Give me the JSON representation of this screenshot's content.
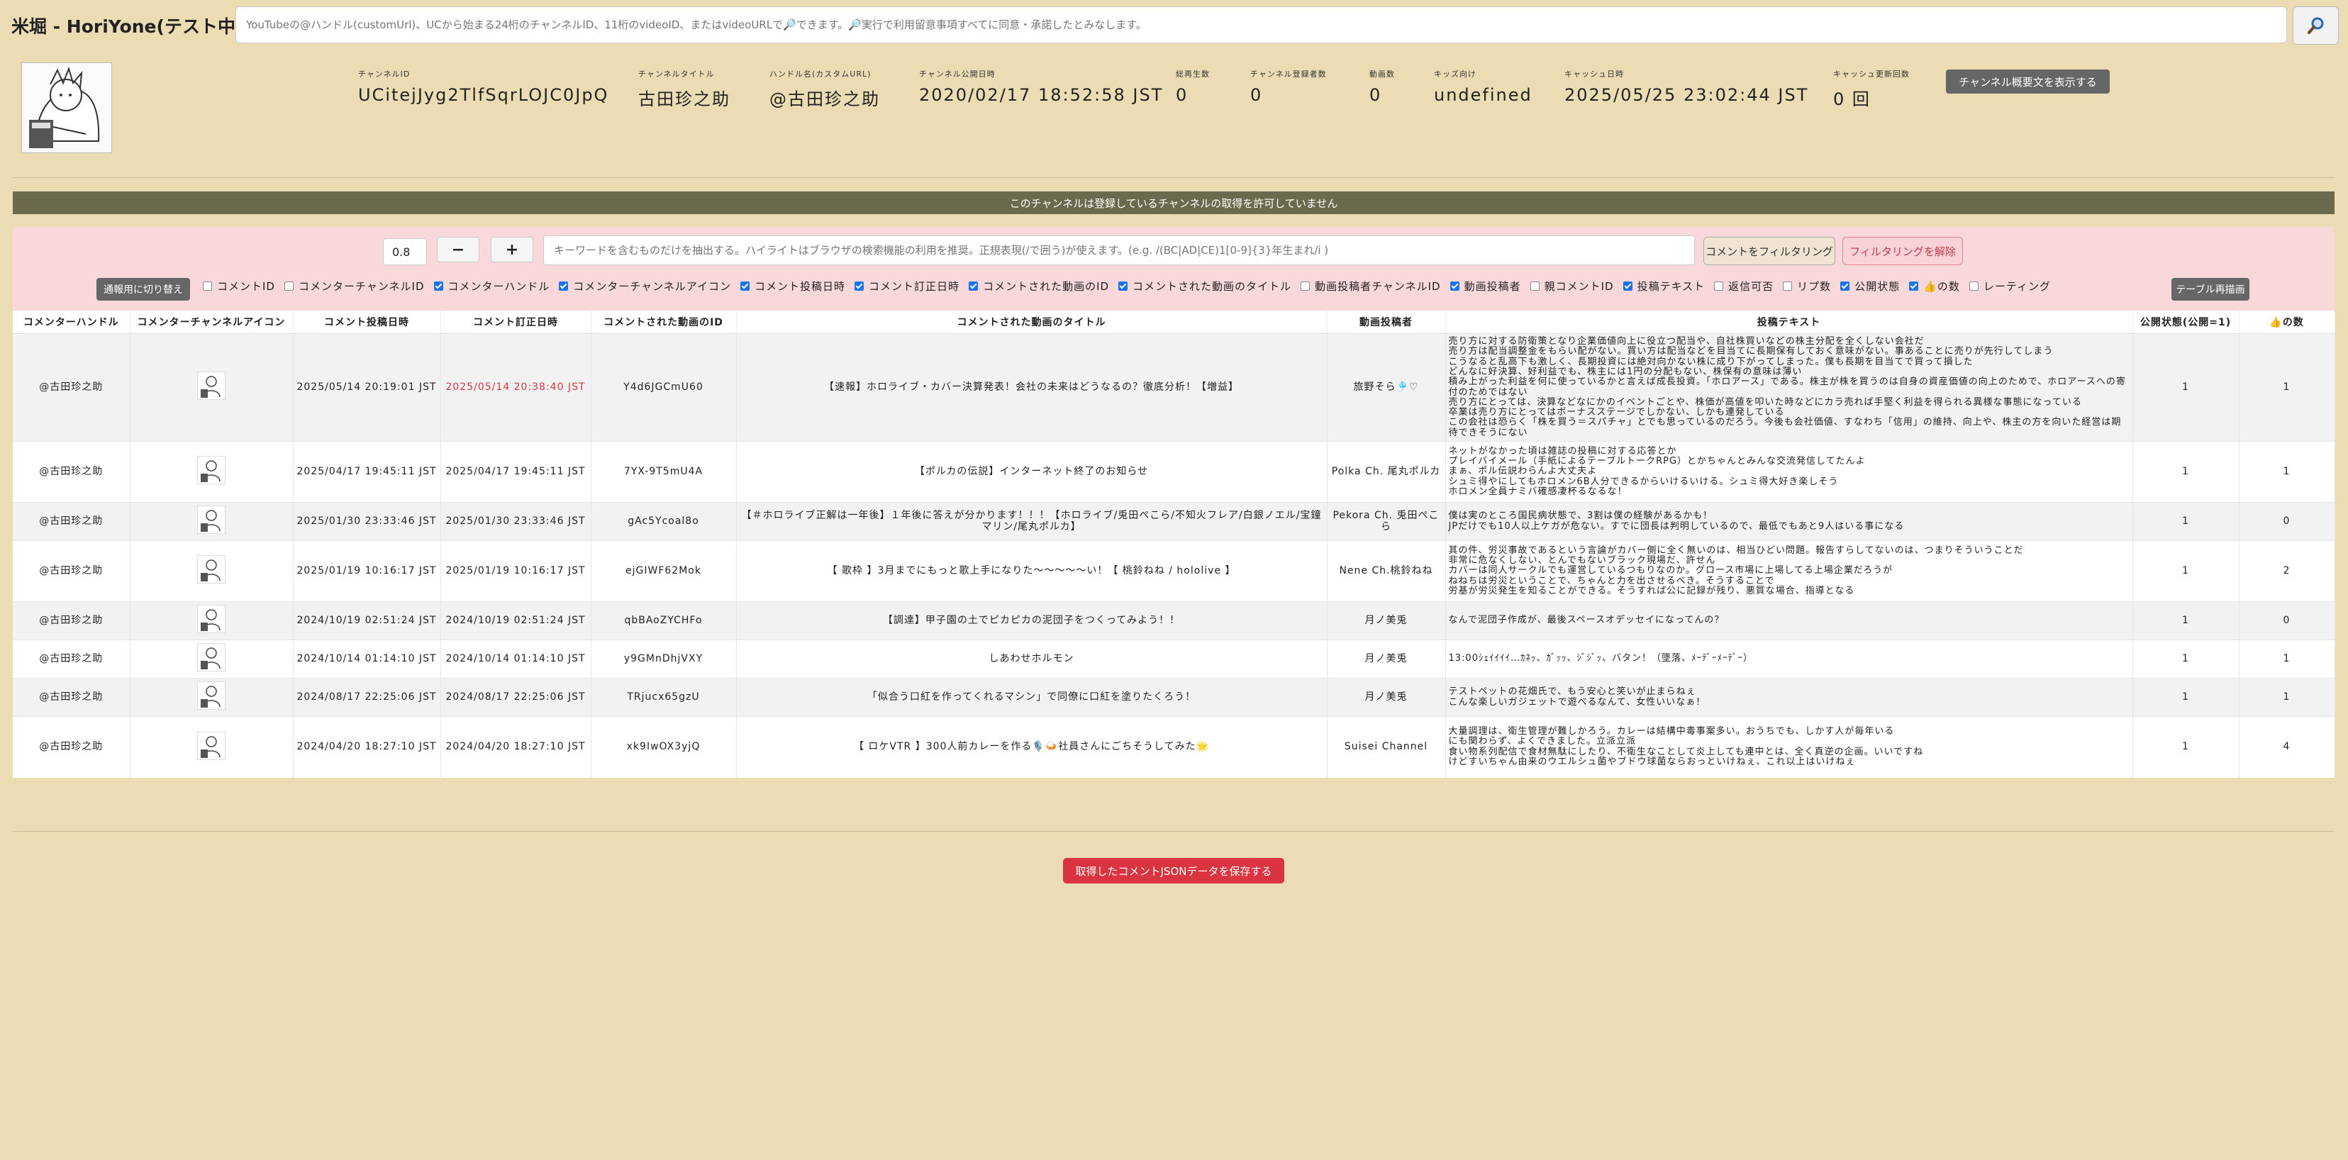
{
  "app": {
    "title": "米堀 - HoriYone(テスト中)"
  },
  "search": {
    "placeholder": "YouTubeの@ハンドル(customUrl)、UCから始まる24桁のチャンネルID、11桁のvideoID、またはvideoURLで🔎できます。🔎実行で利用留意事項すべてに同意・承諾したとみなします。",
    "button_icon": "search-icon"
  },
  "channel": {
    "id_label": "チャンネルID",
    "id": "UCitejJyg2TlfSqrLOJC0JpQ",
    "title_label": "チャンネルタイトル",
    "title": "古田珍之助",
    "handle_label": "ハンドル名(カスタムURL)",
    "handle": "@古田珍之助",
    "published_label": "チャンネル公開日時",
    "published": "2020/02/17 18:52:58 JST",
    "views_label": "総再生数",
    "views": "0",
    "subs_label": "チャンネル登録者数",
    "subs": "0",
    "videos_label": "動画数",
    "videos": "0",
    "kids_label": "キッズ向け",
    "kids": "undefined",
    "cache_label": "キャッシュ日時",
    "cache": "2025/05/25 23:02:44 JST",
    "cache_count_label": "キャッシュ更新回数",
    "cache_count": "0 回",
    "desc_button": "チャンネル概要文を表示する"
  },
  "notice": "このチャンネルは登録しているチャンネルの取得を許可していません",
  "filter": {
    "threshold": "0.8",
    "keyword_placeholder": "キーワードを含むものだけを抽出する。ハイライトはブラウザの検索機能の利用を推奨。正規表現(/で囲う)が使えます。(e.g. /(BC|AD|CE)1[0-9]{3}年生まれ/i )",
    "filter_button": "コメントをフィルタリング",
    "clear_button": "フィルタリングを解除",
    "toggle_button": "通報用に切り替え",
    "redraw_button": "テーブル再描画",
    "column_options": [
      {
        "label": "コメントID",
        "checked": false
      },
      {
        "label": "コメンターチャンネルID",
        "checked": false
      },
      {
        "label": "コメンターハンドル",
        "checked": true
      },
      {
        "label": "コメンターチャンネルアイコン",
        "checked": true
      },
      {
        "label": "コメント投稿日時",
        "checked": true
      },
      {
        "label": "コメント訂正日時",
        "checked": true
      },
      {
        "label": "コメントされた動画のID",
        "checked": true
      },
      {
        "label": "コメントされた動画のタイトル",
        "checked": true
      },
      {
        "label": "動画投稿者チャンネルID",
        "checked": false
      },
      {
        "label": "動画投稿者",
        "checked": true
      },
      {
        "label": "親コメントID",
        "checked": false
      },
      {
        "label": "投稿テキスト",
        "checked": true
      },
      {
        "label": "返信可否",
        "checked": false
      },
      {
        "label": "リプ数",
        "checked": false
      },
      {
        "label": "公開状態",
        "checked": true
      },
      {
        "label": "👍の数",
        "checked": true
      },
      {
        "label": "レーティング",
        "checked": false
      }
    ]
  },
  "table": {
    "headers": [
      "コメンターハンドル",
      "コメンターチャンネルアイコン",
      "コメント投稿日時",
      "コメント訂正日時",
      "コメントされた動画のID",
      "コメントされた動画のタイトル",
      "動画投稿者",
      "投稿テキスト",
      "公開状態(公開=1)",
      "👍の数"
    ],
    "rows": [
      {
        "handle": "@古田珍之助",
        "posted": "2025/05/14 20:19:01 JST",
        "edited": "2025/05/14 20:38:40 JST",
        "edited_highlight": true,
        "video_id": "Y4d6JGCmU60",
        "video_title": "【速報】ホロライブ・カバー決算発表！会社の未来はどうなるの？徹底分析！【増益】",
        "uploader": "旅野そら🎐♡",
        "text": "売り方に対する防衛策となり企業価値向上に役立つ配当や、自社株買いなどの株主分配を全くしない会社だ\n売り方は配当調整金をもらい配がない。買い方は配当などを目当てに長期保有しておく意味がない。事あることに売りが先行してしまう\nこうなると乱高下も激しく、長期投資には絶対向かない株に成り下がってしまった。僕も長期を目当てで買って損した\nどんなに好決算、好利益でも、株主には1円の分配もない、株保有の意味は薄い\n積み上がった利益を何に使っているかと言えば成長投資。「ホロアース」である。株主が株を買うのは自身の資産価値の向上のためで、ホロアースへの寄付のためではない\n売り方にとっては、決算などなにかのイベントごとや、株価が高値を叩いた時などにカラ売れば手堅く利益を得られる異様な事態になっている\n卒業は売り方にとってはボーナスステージでしかない、しかも連発している\nこの会社は恐らく「株を買う＝スパチャ」とでも思っているのだろう。今後も会社価値、すなわち「信用」の維持、向上や、株主の方を向いた経営は期待できそうにない",
        "visibility": "1",
        "likes": "1"
      },
      {
        "handle": "@古田珍之助",
        "posted": "2025/04/17 19:45:11 JST",
        "edited": "2025/04/17 19:45:11 JST",
        "edited_highlight": false,
        "video_id": "7YX-9T5mU4A",
        "video_title": "【ポルカの伝説】インターネット終了のお知らせ",
        "uploader": "Polka Ch. 尾丸ポルカ",
        "text": "ネットがなかった頃は雑誌の投稿に対する応答とか\nプレイバイメール（手紙によるテーブルトークRPG）とかちゃんとみんな交流発信してたんよ\nまぁ、ポル伝説わらんよ大丈夫よ\nシュミ得やにしてもホロメン6B人分できるからいけるいける。シュミ得大好き楽しそう\nホロメン全員ナミバ確感凄杯るなるな！",
        "visibility": "1",
        "likes": "1"
      },
      {
        "handle": "@古田珍之助",
        "posted": "2025/01/30 23:33:46 JST",
        "edited": "2025/01/30 23:33:46 JST",
        "edited_highlight": false,
        "video_id": "gAc5Ycoal8o",
        "video_title": "【＃ホロライブ正解は一年後】１年後に答えが分かります！！！【ホロライブ/兎田ぺこら/不知火フレア/白銀ノエル/宝鐘マリン/尾丸ポルカ】",
        "uploader": "Pekora Ch. 兎田ぺこら",
        "text": "僕は実のところ国民病状態で、3割は僕の経験があるかも！\nJPだけでも10人以上ケガが危ない。すでに団長は判明しているので、最低でもあと9人はいる事になる",
        "visibility": "1",
        "likes": "0"
      },
      {
        "handle": "@古田珍之助",
        "posted": "2025/01/19 10:16:17 JST",
        "edited": "2025/01/19 10:16:17 JST",
        "edited_highlight": false,
        "video_id": "ejGIWF62Mok",
        "video_title": "【 歌枠 】3月までにもっと歌上手になりた～～～～～い！【 桃鈴ねね / hololive 】",
        "uploader": "Nene Ch.桃鈴ねね",
        "text": "其の件、労災事故であるという言論がカバー側に全く無いのは、相当ひどい問題。報告すらしてないのは、つまりそういうことだ\n非常に危なくしない、とんでもないブラック現場だ、許せん\nカバーは同人サークルでも運営しているつもりなのか。グロース市場に上場してる上場企業だろうが\nねねちは労災ということで、ちゃんと力を出させるべき。そうすることで\n労基が労災発生を知ることができる。そうすれば公に記録が残り、悪質な場合、指導となる",
        "visibility": "1",
        "likes": "2"
      },
      {
        "handle": "@古田珍之助",
        "posted": "2024/10/19 02:51:24 JST",
        "edited": "2024/10/19 02:51:24 JST",
        "edited_highlight": false,
        "video_id": "qbBAoZYCHFo",
        "video_title": "【調達】甲子園の土でピカピカの泥団子をつくってみよう！！",
        "uploader": "月ノ美兎",
        "text": "なんで泥団子作成が、最後スペースオデッセイになってんの？",
        "visibility": "1",
        "likes": "0"
      },
      {
        "handle": "@古田珍之助",
        "posted": "2024/10/14 01:14:10 JST",
        "edited": "2024/10/14 01:14:10 JST",
        "edited_highlight": false,
        "video_id": "y9GMnDhjVXY",
        "video_title": "しあわせホルモン",
        "uploader": "月ノ美兎",
        "text": "13:00ｼｪｲｲｲｲ…ｶﾈｯ、ｶﾞｯｯ、ｼﾞｼﾞｯ、バタン！（墜落、ﾒｰﾃﾞｰﾒｰﾃﾞｰ）",
        "visibility": "1",
        "likes": "1"
      },
      {
        "handle": "@古田珍之助",
        "posted": "2024/08/17 22:25:06 JST",
        "edited": "2024/08/17 22:25:06 JST",
        "edited_highlight": false,
        "video_id": "TRjucx65gzU",
        "video_title": "「似合う口紅を作ってくれるマシン」で同僚に口紅を塗りたくろう！",
        "uploader": "月ノ美兎",
        "text": "テストペットの花畑氏で、もう安心と笑いが止まらねぇ\nこんな楽しいガジェットで遊べるなんて、女性いいなぁ！",
        "visibility": "1",
        "likes": "1"
      },
      {
        "handle": "@古田珍之助",
        "posted": "2024/04/20 18:27:10 JST",
        "edited": "2024/04/20 18:27:10 JST",
        "edited_highlight": false,
        "video_id": "xk9IwOX3yjQ",
        "video_title": "【 ロケVTR 】300人前カレーを作る🎙️🍛社員さんにごちそうしてみた🌟",
        "uploader": "Suisei Channel",
        "text": "大量調理は、衛生管理が難しかろう。カレーは結構中毒事案多い。おうちでも、しかす人が毎年いる\nにも関わらず、よくできました。立派立派\n食い物系列配信で食材無駄にしたり、不衛生なことして炎上しても連中とは、全く真逆の企画。いいですね\nけどすいちゃん由来のウエルシュ菌やブドウ球菌ならおっといけねぇ、これ以上はいけねぇ",
        "visibility": "1",
        "likes": "4"
      }
    ]
  },
  "save_button": "取得したコメントJSONデータを保存する",
  "colors": {
    "background": "#ecdcb3",
    "notice_bar": "#6b6a4e",
    "filter_panel": "#f8d8db",
    "save_button": "#d9343f",
    "edited_red": "#d9343f"
  }
}
